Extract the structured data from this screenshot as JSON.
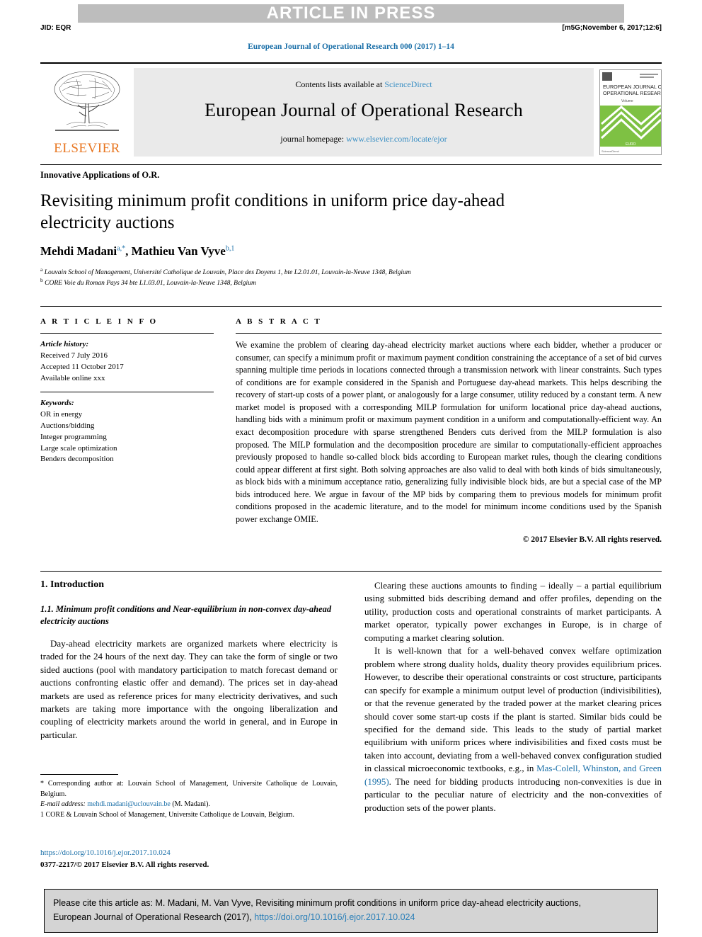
{
  "banner": {
    "article_in_press": "ARTICLE IN PRESS",
    "jid": "JID: EQR",
    "stamp": "[m5G;November 6, 2017;12:6]",
    "journal_ref": "European Journal of Operational Research 000 (2017) 1–14"
  },
  "masthead": {
    "contents_prefix": "Contents lists available at ",
    "sciencedirect": "ScienceDirect",
    "journal_name": "European Journal of Operational Research",
    "homepage_prefix": "journal homepage: ",
    "homepage_url": "www.elsevier.com/locate/ejor",
    "publisher": "ELSEVIER",
    "cover_title_line1": "EUROPEAN JOURNAL OF",
    "cover_title_line2": "OPERATIONAL RESEARCH"
  },
  "article": {
    "section": "Innovative Applications of O.R.",
    "title": "Revisiting minimum profit conditions in uniform price day-ahead electricity auctions",
    "authors_html": "Mehdi Madani, Mathieu Van Vyve",
    "author1": "Mehdi Madani",
    "author1_sup": "a,*",
    "author2": "Mathieu Van Vyve",
    "author2_sup": "b,1",
    "affiliation_a": "Louvain School of Management, Université Catholique de Louvain, Place des Doyens 1, bte L2.01.01, Louvain-la-Neuve 1348, Belgium",
    "affiliation_b": "CORE Voie du Roman Pays 34 bte L1.03.01, Louvain-la-Neuve 1348, Belgium"
  },
  "info": {
    "heading": "A R T I C L E    I N F O",
    "history_label": "Article history:",
    "received": "Received 7 July 2016",
    "accepted": "Accepted 11 October 2017",
    "available": "Available online xxx",
    "keywords_label": "Keywords:",
    "keywords": [
      "OR in energy",
      "Auctions/bidding",
      "Integer programming",
      "Large scale optimization",
      "Benders decomposition"
    ]
  },
  "abstract": {
    "heading": "A B S T R A C T",
    "text": "We examine the problem of clearing day-ahead electricity market auctions where each bidder, whether a producer or consumer, can specify a minimum profit or maximum payment condition constraining the acceptance of a set of bid curves spanning multiple time periods in locations connected through a transmission network with linear constraints. Such types of conditions are for example considered in the Spanish and Portuguese day-ahead markets. This helps describing the recovery of start-up costs of a power plant, or analogously for a large consumer, utility reduced by a constant term. A new market model is proposed with a corresponding MILP formulation for uniform locational price day-ahead auctions, handling bids with a minimum profit or maximum payment condition in a uniform and computationally-efficient way. An exact decomposition procedure with sparse strengthened Benders cuts derived from the MILP formulation is also proposed. The MILP formulation and the decomposition procedure are similar to computationally-efficient approaches previously proposed to handle so-called block bids according to European market rules, though the clearing conditions could appear different at first sight. Both solving approaches are also valid to deal with both kinds of bids simultaneously, as block bids with a minimum acceptance ratio, generalizing fully indivisible block bids, are but a special case of the MP bids introduced here. We argue in favour of the MP bids by comparing them to previous models for minimum profit conditions proposed in the academic literature, and to the model for minimum income conditions used by the Spanish power exchange OMIE.",
    "copyright": "© 2017 Elsevier B.V. All rights reserved."
  },
  "body": {
    "intro_heading": "1. Introduction",
    "subsection_heading": "1.1. Minimum profit conditions and Near-equilibrium in non-convex day-ahead electricity auctions",
    "left_p1": "Day-ahead electricity markets are organized markets where electricity is traded for the 24 hours of the next day. They can take the form of single or two sided auctions (pool with mandatory participation to match forecast demand or auctions confronting elastic offer and demand). The prices set in day-ahead markets are used as reference prices for many electricity derivatives, and such markets are taking more importance with the ongoing liberalization and coupling of electricity markets around the world in general, and in Europe in particular.",
    "right_p1": "Clearing these auctions amounts to finding – ideally – a partial equilibrium using submitted bids describing demand and offer profiles, depending on the utility, production costs and operational constraints of market participants. A market operator, typically power exchanges in Europe, is in charge of computing a market clearing solution.",
    "right_p2_part1": "It is well-known that for a well-behaved convex welfare optimization problem where strong duality holds, duality theory provides equilibrium prices. However, to describe their operational constraints or cost structure, participants can specify for example a minimum output level of production (indivisibilities), or that the revenue generated by the traded power at the market clearing prices should cover some start-up costs if the plant is started. Similar bids could be specified for the demand side. This leads to the study of partial market equilibrium with uniform prices where indivisibilities and fixed costs must be taken into account, deviating from a well-behaved convex configuration studied in classical microeconomic textbooks, e.g., in ",
    "right_p2_citation": "Mas-Colell, Whinston, and Green (1995)",
    "right_p2_part2": ". The need for bidding products introducing non-convexities is due in particular to the peculiar nature of electricity and the non-convexities of production sets of the power plants."
  },
  "footnotes": {
    "corresponding": "* Corresponding author at: Louvain School of Management, Universite Catholique de Louvain, Belgium.",
    "email_label": "E-mail address:",
    "email": "mehdi.madani@uclouvain.be",
    "email_suffix": "(M. Madani).",
    "note1": "1 CORE & Louvain School of Management, Universite Catholique de Louvain, Belgium.",
    "doi": "https://doi.org/10.1016/j.ejor.2017.10.024",
    "rights": "0377-2217/© 2017 Elsevier B.V. All rights reserved."
  },
  "cite_box": {
    "line1": "Please cite this article as: M. Madani, M. Van Vyve, Revisiting minimum profit conditions in uniform price day-ahead electricity auctions,",
    "line2_prefix": "European Journal of Operational Research (2017), ",
    "line2_doi": "https://doi.org/10.1016/j.ejor.2017.10.024"
  },
  "colors": {
    "link": "#1a6fa8",
    "elsevier_orange": "#E87722",
    "banner_gray": "#bdbdbd",
    "cite_gray": "#d4d4d4"
  }
}
